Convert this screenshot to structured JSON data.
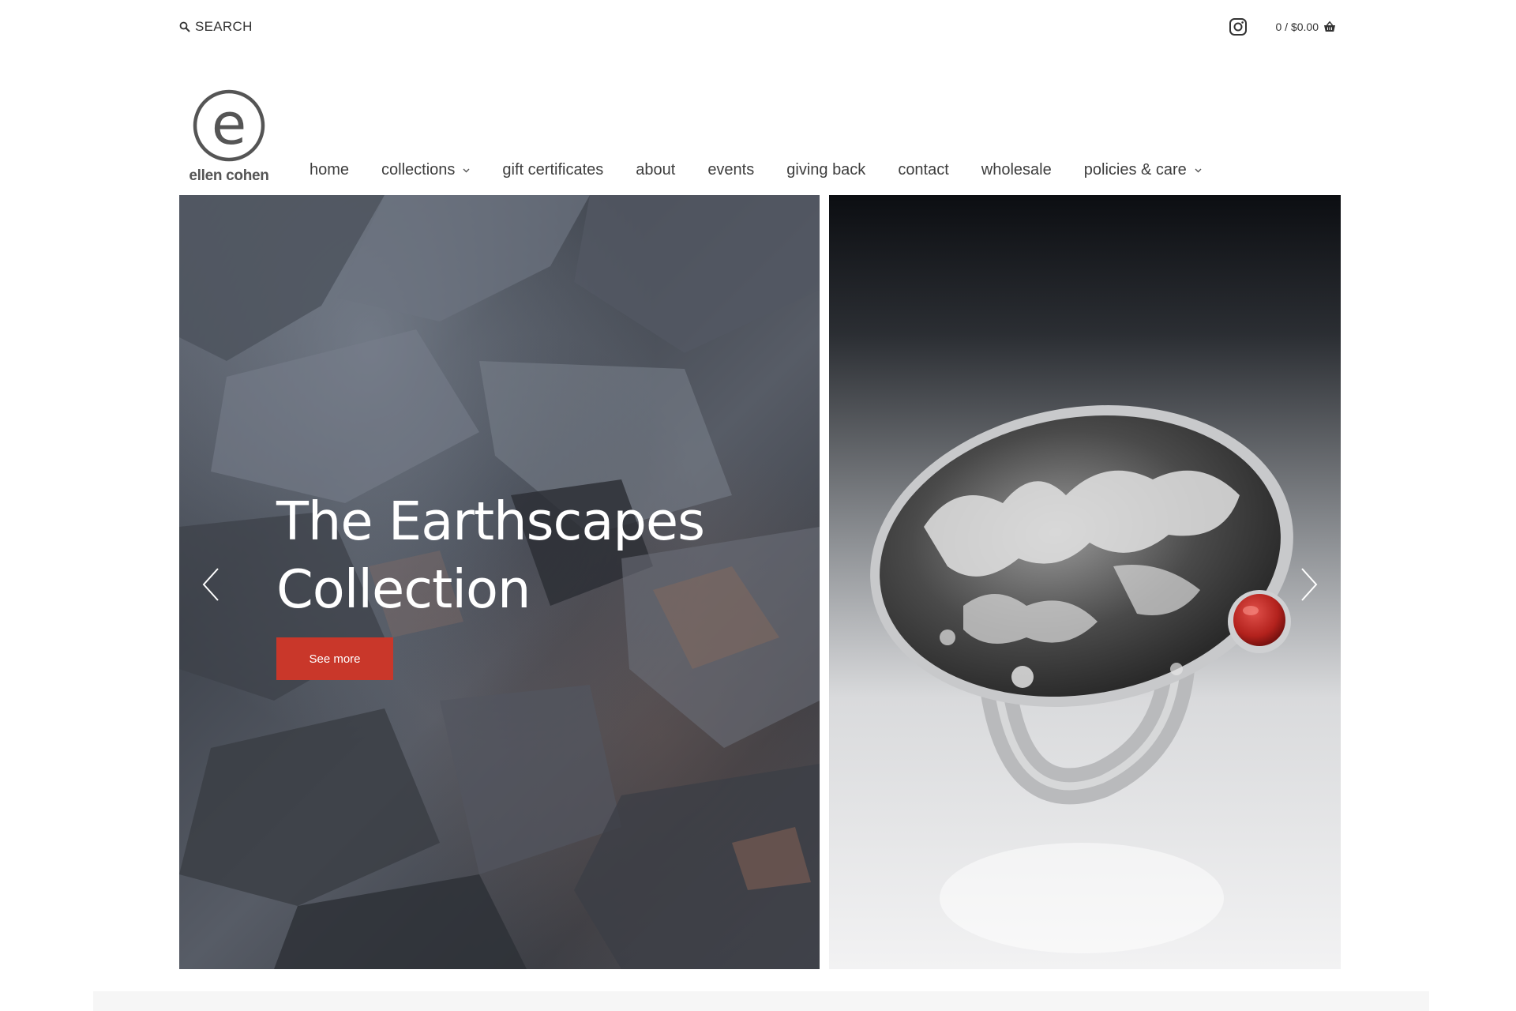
{
  "header": {
    "search_label": "SEARCH",
    "cart_label": "0 / $0.00"
  },
  "logo": {
    "letter": "e",
    "name": "ellen cohen"
  },
  "nav": {
    "items": [
      {
        "label": "home",
        "dropdown": false
      },
      {
        "label": "collections",
        "dropdown": true
      },
      {
        "label": "gift certificates",
        "dropdown": false
      },
      {
        "label": "about",
        "dropdown": false
      },
      {
        "label": "events",
        "dropdown": false
      },
      {
        "label": "giving back",
        "dropdown": false
      },
      {
        "label": "contact",
        "dropdown": false
      },
      {
        "label": "wholesale",
        "dropdown": false
      },
      {
        "label": "policies & care",
        "dropdown": true
      }
    ]
  },
  "hero": {
    "title_line1": "The Earthscapes",
    "title_line2": "Collection",
    "button_label": "See more",
    "accent_color": "#c9372a"
  },
  "icons": {
    "search": "search-icon",
    "instagram": "instagram-icon",
    "cart": "basket-icon",
    "prev": "chevron-left-icon",
    "next": "chevron-right-icon"
  }
}
